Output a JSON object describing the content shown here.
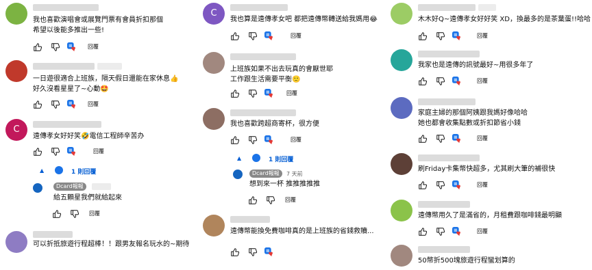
{
  "labels": {
    "reply": "回覆"
  },
  "col1": {
    "c1": {
      "text1": "我也喜歡演唱會或展覽門票有會員折扣那個",
      "text2": "希望以後能多推出一些!"
    },
    "c2": {
      "text1": "一日遊很適合上班族，隔天假日還能在家休息👍",
      "text2": "好久沒看星星了~心動🤩"
    },
    "c3": {
      "avatar_letter": "C",
      "text1": "遠傳孝女好好笑🤣電信工程師辛苦办",
      "replies_label": "1 則回覆",
      "reply": {
        "badge": "Dcard報報",
        "text": "給五顆星我們就給起來"
      }
    },
    "c4": {
      "text1": "可以折抵旅遊行程超棒！！跟男友報名玩水的~期待"
    }
  },
  "col2": {
    "c1": {
      "avatar_letter": "C",
      "text1": "我也算是遠傳孝女吧 都把遠傳幣轉送給我媽用😂"
    },
    "c2": {
      "text1": "上班族如果不出去玩真的會厭世耶",
      "text2": "工作跟生活需要平衡🙂"
    },
    "c3": {
      "text1": "我也喜歡跨超商寄杯，很方便",
      "replies_label": "1 則回覆",
      "reply": {
        "badge": "Dcard報報",
        "time": "7 天前",
        "text": "想到來一杯 推推推推推"
      }
    },
    "c4": {
      "text1": "遠傳幣能換免費咖啡真的是上班族的省錢救贖..."
    }
  },
  "col3": {
    "c1": {
      "text1": "木木好Q~遠傳孝女好好笑 XD，換最多的是茶葉蛋!!哈哈"
    },
    "c2": {
      "text1": "我家也是遠傳的訊號最好~用很多年了"
    },
    "c3": {
      "text1": "家庭主婦的那個阿姨跟我媽好像哈哈",
      "text2": "她也都會收集點數或折扣節省小錢"
    },
    "c4": {
      "text1": "刷Friday卡集幣快超多，尤其刷大筆的補很快"
    },
    "c5": {
      "text1": "遠傳幣用久了是滿省的，月租費跟咖啡錢最明顯"
    },
    "c6": {
      "text1": "50幣折500塊旅遊行程蠻划算的"
    }
  },
  "colors": {
    "link": "#065fd4",
    "heart": "#e53935",
    "badge": "#888888"
  },
  "icons": [
    "thumb-up-icon",
    "thumb-down-icon",
    "creator-heart-icon",
    "collapse-caret-icon"
  ]
}
